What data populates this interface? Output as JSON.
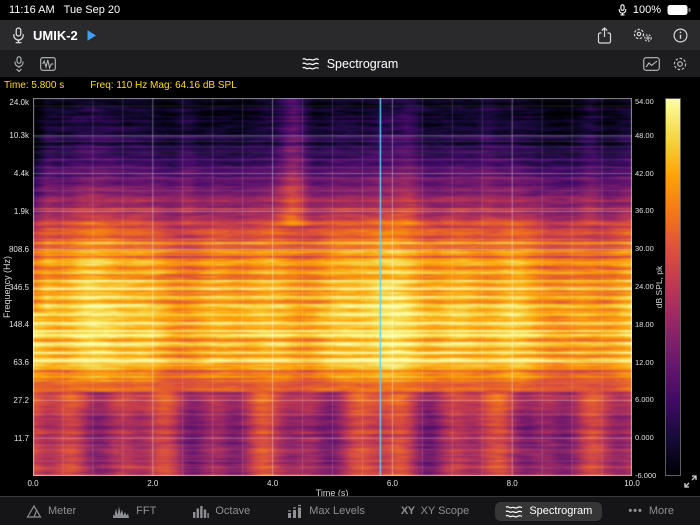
{
  "status_bar": {
    "time": "11:16 AM",
    "date": "Tue Sep 20",
    "battery_percent": "100%"
  },
  "toolbar": {
    "device_name": "UMIK-2"
  },
  "header": {
    "title": "Spectrogram"
  },
  "readout": {
    "time": "Time: 5.800 s",
    "freq_mag": "Freq: 110 Hz Mag: 64.16 dB SPL"
  },
  "colors": {
    "readout_text": "#ffdf00",
    "accent_blue": "#3f9fff",
    "cursor": "#5fd0ff"
  },
  "chart_data": {
    "type": "heatmap",
    "title": "Spectrogram",
    "xlabel": "Time (s)",
    "ylabel": "Frequency (Hz)",
    "colorbar_label": "dB SPL, pk",
    "x_ticks": [
      "0.0",
      "2.0",
      "4.0",
      "6.0",
      "8.0",
      "10.0"
    ],
    "y_ticks": [
      "24.0k",
      "10.3k",
      "4.4k",
      "1.9k",
      "808.6",
      "346.5",
      "148.4",
      "63.6",
      "27.2",
      "11.7"
    ],
    "colorbar_ticks": [
      "54.00",
      "48.00",
      "42.00",
      "36.00",
      "30.00",
      "24.00",
      "18.00",
      "12.00",
      "6.000",
      "0.000",
      "-6.000"
    ],
    "time_range_s": [
      0,
      10
    ],
    "freq_range_hz": [
      5,
      24000
    ],
    "db_range": [
      -6,
      54
    ],
    "cursor_time_s": 5.8,
    "cursor_color": "#5fd0ff",
    "colormap": [
      {
        "t": 0.0,
        "color": "#000004"
      },
      {
        "t": 0.1,
        "color": "#160b39"
      },
      {
        "t": 0.2,
        "color": "#420a68"
      },
      {
        "t": 0.3,
        "color": "#6a176e"
      },
      {
        "t": 0.4,
        "color": "#932667"
      },
      {
        "t": 0.5,
        "color": "#bc3754"
      },
      {
        "t": 0.6,
        "color": "#dd513a"
      },
      {
        "t": 0.7,
        "color": "#f37819"
      },
      {
        "t": 0.8,
        "color": "#fca50a"
      },
      {
        "t": 0.9,
        "color": "#f6d746"
      },
      {
        "t": 1.0,
        "color": "#fcffa4"
      }
    ],
    "freq_profile_db": [
      [
        24000,
        -4
      ],
      [
        9000,
        1
      ],
      [
        3500,
        12
      ],
      [
        1600,
        25
      ],
      [
        1000,
        35
      ],
      [
        450,
        41
      ],
      [
        250,
        45
      ],
      [
        100,
        45
      ],
      [
        60,
        42
      ],
      [
        32,
        31
      ],
      [
        14,
        23
      ],
      [
        5,
        26
      ]
    ],
    "features": {
      "tonal_line_hz": 65,
      "broadband_transient_times_s": [
        2.55,
        4.35,
        6.3,
        7.6,
        9.35
      ]
    }
  },
  "tab_bar": {
    "selected": "Spectrogram",
    "items": [
      {
        "label": "Meter"
      },
      {
        "label": "FFT"
      },
      {
        "label": "Octave"
      },
      {
        "label": "Max Levels"
      },
      {
        "label": "XY Scope",
        "icon_text": "XY"
      },
      {
        "label": "Spectrogram"
      },
      {
        "label": "More",
        "icon_text": "•••"
      }
    ]
  }
}
